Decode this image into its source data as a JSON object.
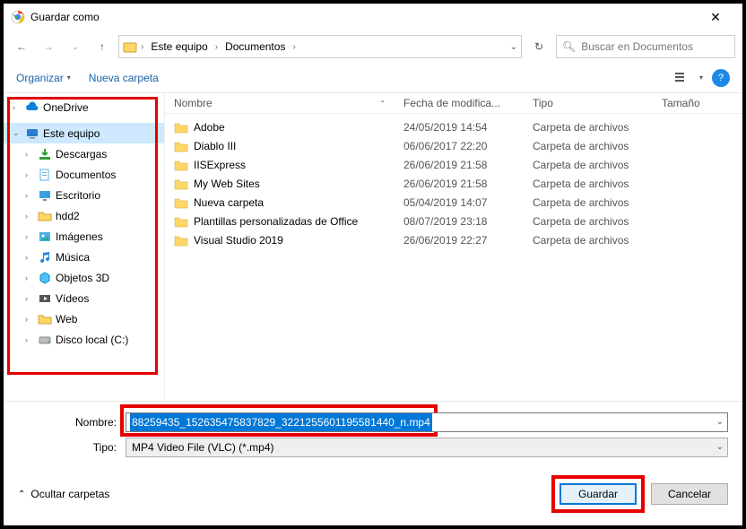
{
  "window_title": "Guardar como",
  "breadcrumb": {
    "root": "Este equipo",
    "folder": "Documentos"
  },
  "search_placeholder": "Buscar en Documentos",
  "toolbar": {
    "organize": "Organizar",
    "new_folder": "Nueva carpeta"
  },
  "sidebar": {
    "items": [
      {
        "label": "OneDrive",
        "icon": "cloud",
        "chev": "›",
        "indent": 0
      },
      {
        "label": "Este equipo",
        "icon": "pc",
        "chev": "⌄",
        "indent": 0,
        "sel": true
      },
      {
        "label": "Descargas",
        "icon": "download",
        "chev": "›",
        "indent": 1
      },
      {
        "label": "Documentos",
        "icon": "docs",
        "chev": "›",
        "indent": 1
      },
      {
        "label": "Escritorio",
        "icon": "desktop",
        "chev": "›",
        "indent": 1
      },
      {
        "label": "hdd2",
        "icon": "folder",
        "chev": "›",
        "indent": 1
      },
      {
        "label": "Imágenes",
        "icon": "images",
        "chev": "›",
        "indent": 1
      },
      {
        "label": "Música",
        "icon": "music",
        "chev": "›",
        "indent": 1
      },
      {
        "label": "Objetos 3D",
        "icon": "3d",
        "chev": "›",
        "indent": 1
      },
      {
        "label": "Vídeos",
        "icon": "video",
        "chev": "›",
        "indent": 1
      },
      {
        "label": "Web",
        "icon": "folder",
        "chev": "›",
        "indent": 1
      },
      {
        "label": "Disco local (C:)",
        "icon": "drive",
        "chev": "›",
        "indent": 1
      }
    ]
  },
  "columns": {
    "name": "Nombre",
    "date": "Fecha de modifica...",
    "type": "Tipo",
    "size": "Tamaño"
  },
  "files": [
    {
      "name": "Adobe",
      "date": "24/05/2019 14:54",
      "type": "Carpeta de archivos"
    },
    {
      "name": "Diablo III",
      "date": "06/06/2017 22:20",
      "type": "Carpeta de archivos"
    },
    {
      "name": "IISExpress",
      "date": "26/06/2019 21:58",
      "type": "Carpeta de archivos"
    },
    {
      "name": "My Web Sites",
      "date": "26/06/2019 21:58",
      "type": "Carpeta de archivos"
    },
    {
      "name": "Nueva carpeta",
      "date": "05/04/2019 14:07",
      "type": "Carpeta de archivos"
    },
    {
      "name": "Plantillas personalizadas de Office",
      "date": "08/07/2019 23:18",
      "type": "Carpeta de archivos"
    },
    {
      "name": "Visual Studio 2019",
      "date": "26/06/2019 22:27",
      "type": "Carpeta de archivos"
    }
  ],
  "form": {
    "name_label": "Nombre:",
    "name_value": "88259435_152635475837829_3221255601195581440_n.mp4",
    "type_label": "Tipo:",
    "type_value": "MP4 Video File (VLC) (*.mp4)"
  },
  "actions": {
    "hide_folders": "Ocultar carpetas",
    "save": "Guardar",
    "cancel": "Cancelar"
  }
}
